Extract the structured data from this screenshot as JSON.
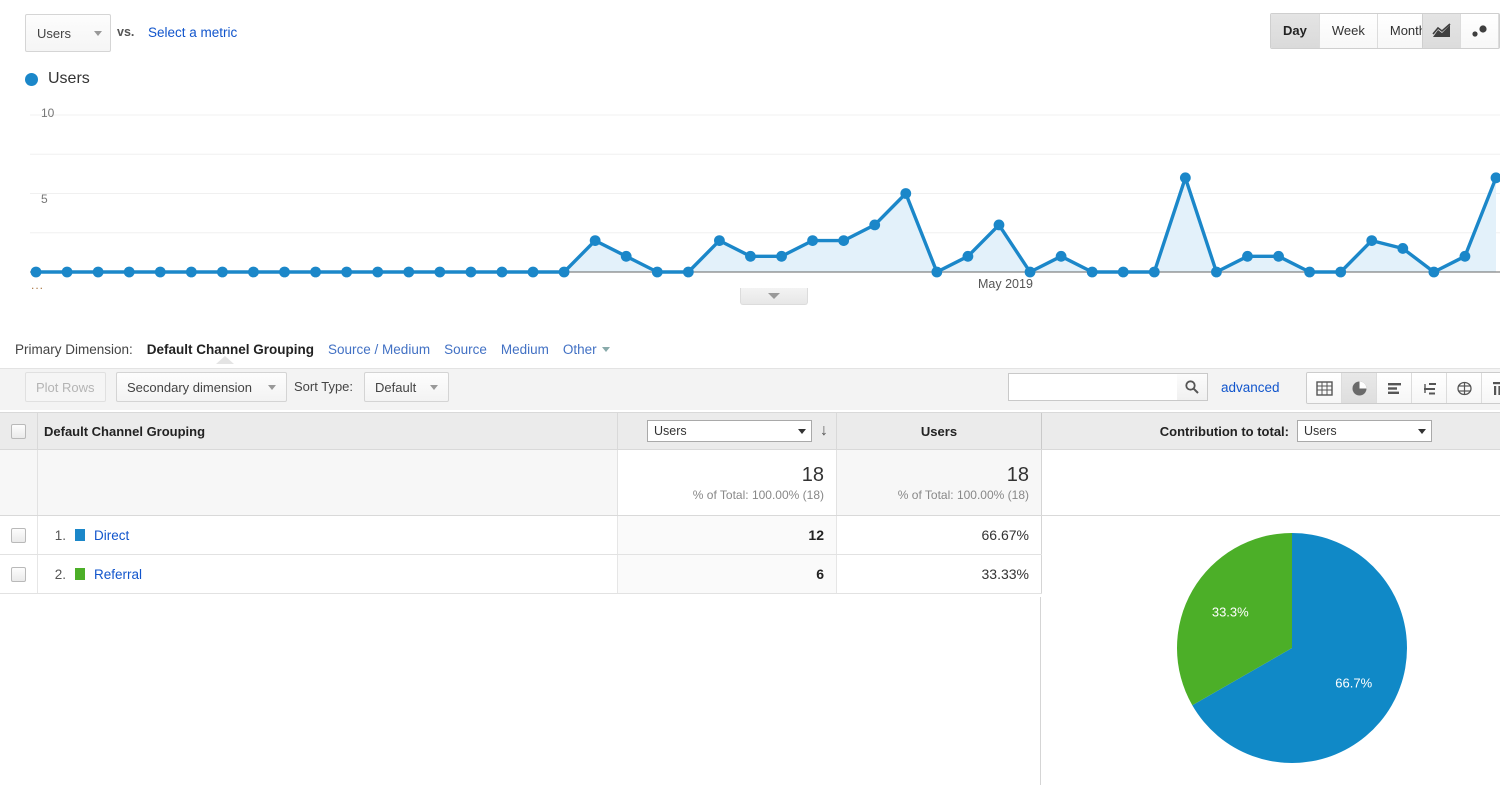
{
  "metric_bar": {
    "primary_metric": "Users",
    "vs_label": "vs.",
    "select_metric_link": "Select a metric",
    "granularity": [
      {
        "label": "Day",
        "selected": true
      },
      {
        "label": "Week",
        "selected": false
      },
      {
        "label": "Month",
        "selected": false
      }
    ],
    "chart_types": [
      {
        "icon": "line-chart-icon",
        "selected": true
      },
      {
        "icon": "motion-chart-icon",
        "selected": false
      }
    ]
  },
  "legend": {
    "series_name": "Users",
    "color": "#1b87c9"
  },
  "chart_data": {
    "type": "line",
    "title": "Users",
    "xlabel": "",
    "ylabel": "Users",
    "ylim": [
      0,
      10
    ],
    "yticks": [
      5,
      10
    ],
    "grid": true,
    "x_axis_label": "May 2019",
    "leading_ellipsis": "...",
    "series": [
      {
        "name": "Users",
        "color": "#1b87c9",
        "values": [
          0,
          0,
          0,
          0,
          0,
          0,
          0,
          0,
          0,
          0,
          0,
          0,
          0,
          0,
          0,
          0,
          0,
          0,
          2,
          1,
          0,
          0,
          2,
          1,
          1,
          2,
          2,
          3,
          5,
          0,
          1,
          3,
          0,
          1,
          0,
          0,
          0,
          6,
          0,
          1,
          1,
          0,
          0,
          2,
          1.5,
          0,
          1,
          6
        ]
      }
    ]
  },
  "primary_dimension": {
    "label": "Primary Dimension:",
    "active": "Default Channel Grouping",
    "links": [
      "Source / Medium",
      "Source",
      "Medium"
    ],
    "other": "Other"
  },
  "controls": {
    "plot_rows": "Plot Rows",
    "secondary_dimension": "Secondary dimension",
    "sort_type_label": "Sort Type:",
    "sort_type_value": "Default",
    "search_value": "",
    "search_placeholder": "",
    "advanced": "advanced",
    "view_icons": [
      {
        "name": "table-view-icon",
        "selected": false
      },
      {
        "name": "pie-view-icon",
        "selected": true
      },
      {
        "name": "bar-view-icon",
        "selected": false
      },
      {
        "name": "performance-view-icon",
        "selected": false
      },
      {
        "name": "comparison-view-icon",
        "selected": false
      },
      {
        "name": "pivot-view-icon",
        "selected": false
      }
    ]
  },
  "table": {
    "dimension_header": "Default Channel Grouping",
    "metric_select_value": "Users",
    "metric2_header": "Users",
    "contribution_label": "Contribution to total:",
    "contribution_value": "Users",
    "totals": {
      "metric1_value": "18",
      "metric1_sub": "% of Total: 100.00% (18)",
      "metric2_value": "18",
      "metric2_sub": "% of Total: 100.00% (18)"
    },
    "rows": [
      {
        "rank": "1.",
        "name": "Direct",
        "color": "#1b87c9",
        "users": "12",
        "percent": "66.67%"
      },
      {
        "rank": "2.",
        "name": "Referral",
        "color": "#4caf28",
        "users": "6",
        "percent": "33.33%"
      }
    ]
  },
  "pie_chart": {
    "type": "pie",
    "labels": [
      "Direct",
      "Referral"
    ],
    "values": [
      66.7,
      33.3
    ],
    "display_labels": [
      "66.7%",
      "33.3%"
    ],
    "colors": [
      "#1089c7",
      "#4caf28"
    ]
  }
}
